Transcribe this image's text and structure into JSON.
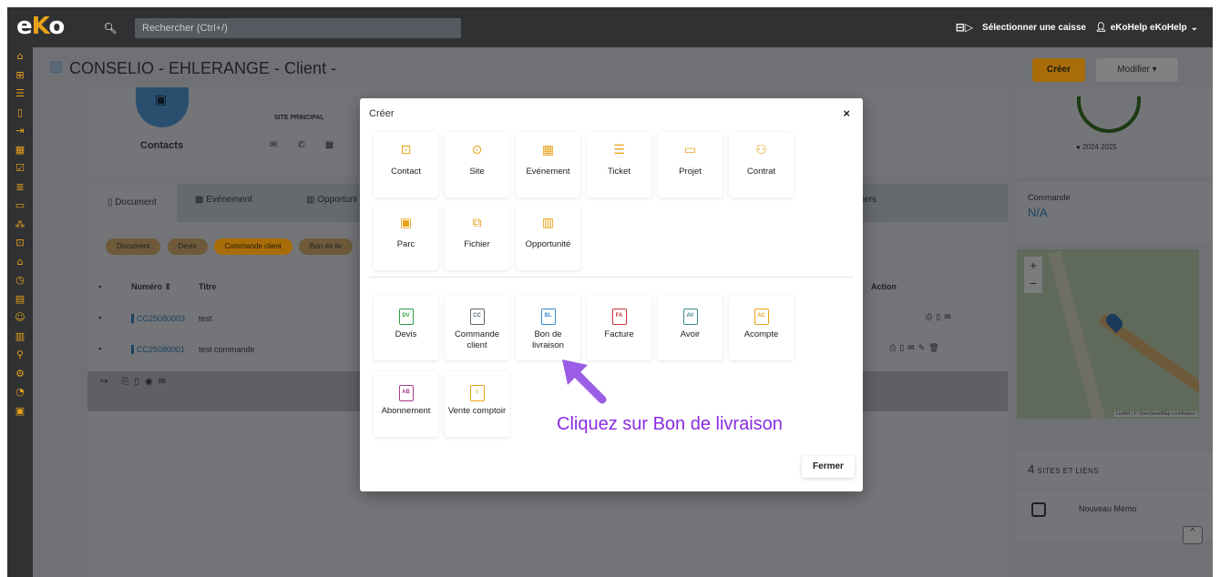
{
  "app": {
    "logo": "eKo"
  },
  "topbar": {
    "search_placeholder": "Rechercher (Ctrl+/)",
    "caisse": "Sélectionner une caisse",
    "user": "eKoHelp eKoHelp"
  },
  "page": {
    "title": "CONSELIO - EHLERANGE - Client -",
    "create_button": "Créer",
    "modify_button": "Modifier"
  },
  "contact_card": {
    "label": "Contacts",
    "site": "SITE PRINCIPAL"
  },
  "stats": {
    "legend": "2024  2025",
    "commande_label": "Commande",
    "commande_value": "N/A"
  },
  "sites": {
    "count": "4",
    "label": "SITES ET LIENS"
  },
  "memo": {
    "label": "Nouveau Mémo"
  },
  "map": {
    "attribution": "Leaflet | © OpenStreetMap contributors",
    "zoom_in": "+",
    "zoom_out": "−"
  },
  "doc_tabs": {
    "document": "Document",
    "evenement": "Evénement",
    "opportunite": "Opportuni",
    "fichiers": "iers"
  },
  "chips": [
    "Document",
    "Devis",
    "Commande client",
    "Bon de liv"
  ],
  "table": {
    "headers": {
      "numero": "Numéro",
      "titre": "Titre",
      "action": "Action"
    },
    "rows": [
      {
        "numero": "CC25080003",
        "titre": "test"
      },
      {
        "numero": "CC25080001",
        "titre": "test commande"
      }
    ]
  },
  "modal": {
    "title": "Créer",
    "close": "×",
    "entity_tiles": [
      {
        "label": "Contact",
        "icon": "contact-icon"
      },
      {
        "label": "Site",
        "icon": "location-pin-icon"
      },
      {
        "label": "Evénement",
        "icon": "calendar-icon"
      },
      {
        "label": "Ticket",
        "icon": "list-check-icon"
      },
      {
        "label": "Projet",
        "icon": "folder-icon"
      },
      {
        "label": "Contrat",
        "icon": "handshake-icon"
      },
      {
        "label": "Parc",
        "icon": "box-icon"
      },
      {
        "label": "Fichier",
        "icon": "files-icon"
      },
      {
        "label": "Opportunité",
        "icon": "bar-chart-icon"
      }
    ],
    "doc_tiles": [
      {
        "label": "Devis",
        "badge": "DV",
        "color": "#2e9e44"
      },
      {
        "label": "Commande client",
        "badge": "CC",
        "color": "#5a6670"
      },
      {
        "label": "Bon de livraison",
        "badge": "BL",
        "color": "#3a8ad0"
      },
      {
        "label": "Facture",
        "badge": "FA",
        "color": "#c8333a"
      },
      {
        "label": "Avoir",
        "badge": "AV",
        "color": "#3e8a8a"
      },
      {
        "label": "Acompte",
        "badge": "AC",
        "color": "#e8a21a"
      },
      {
        "label": "Abonnement",
        "badge": "AB",
        "color": "#a83b8f"
      },
      {
        "label": "Vente comptoir",
        "badge": "≡",
        "color": "#e8a21a"
      }
    ],
    "hint": "Cliquez sur Bon de livraison",
    "close_button": "Fermer"
  },
  "colors": {
    "accent": "#e8a21a",
    "hint": "#8a2be2",
    "arrow": "#9b5de5"
  }
}
